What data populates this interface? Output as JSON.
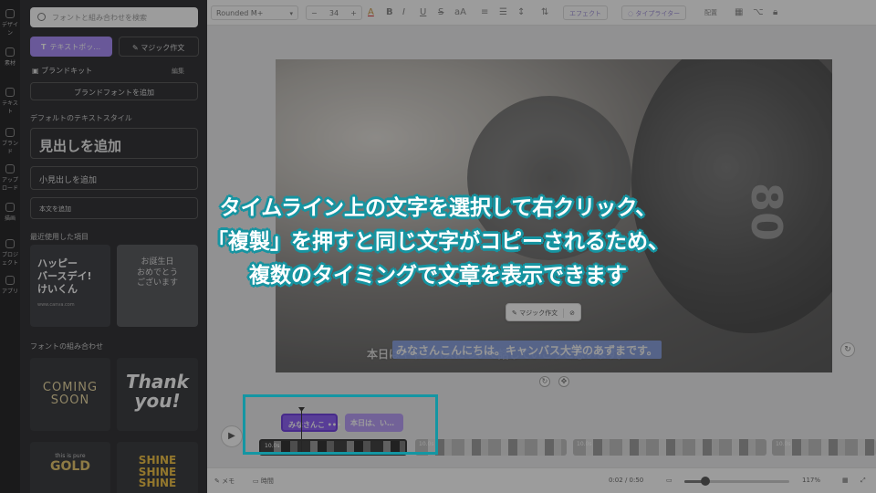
{
  "rail": {
    "items": [
      "デザイン",
      "素材",
      "テキスト",
      "ブランド",
      "アップロード",
      "描画",
      "プロジェクト",
      "アプリ"
    ]
  },
  "panel": {
    "search_placeholder": "フォントと組み合わせを検索",
    "text_box_button": "テキストボッ…",
    "text_box_icon": "T",
    "magic_write_button": "マジック作文",
    "brand_kit": "ブランドキット",
    "brand_kit_edit": "編集",
    "add_brand_font": "ブランドフォントを追加",
    "default_styles_title": "デフォルトのテキストスタイル",
    "add_heading": "見出しを追加",
    "add_subheading": "小見出しを追加",
    "add_body": "本文を追加",
    "recently_used_title": "最近使用した項目",
    "recent_tile_1": [
      "ハッピー",
      "バースデイ!",
      "けいくん"
    ],
    "recent_tile_1_small": "www.canva.com",
    "recent_tile_2": [
      "お誕生日",
      "おめでとう",
      "ございます"
    ],
    "font_combos_title": "フォントの組み合わせ",
    "combo_1": [
      "COMING",
      "SOON"
    ],
    "combo_2": [
      "Thank",
      "you!"
    ],
    "combo_3_small": "this is pure",
    "combo_3_big": "GOLD",
    "combo_4": [
      "SHINE",
      "SHINE",
      "SHINE"
    ]
  },
  "toolbar": {
    "font_name": "Rounded M+",
    "font_size": "34",
    "minus": "−",
    "plus": "+",
    "color_icon": "A",
    "bold": "B",
    "italic": "I",
    "underline": "U",
    "strike": "S",
    "case": "aA",
    "effects": "エフェクト",
    "typewriter": "タイプライター",
    "position": "配置"
  },
  "canvas": {
    "subtitle_back": "本日はキャンバスについて話していこうと思います。",
    "subtitle_selected": "みなさんこんにちは。キャンバス大学のあずまです。",
    "magic_popup": "マジック作文",
    "photo_digits": "80"
  },
  "timeline": {
    "clip_1": "みなさんこ",
    "clip_1_more": "•••",
    "clip_2": "本日は、い…",
    "video_label_1": "10.0s",
    "video_label_2": "10.0s",
    "video_label_3": "10.0s",
    "video_label_4": "10.0s"
  },
  "statusbar": {
    "memo": "メモ",
    "duration": "時間",
    "time": "0:02 / 0:50",
    "zoom": "117%",
    "zoom_fraction": 0.2
  },
  "caption": {
    "line1": "タイムライン上の文字を選択して右クリック、",
    "line2": "「複製」を押すと同じ文字がコピーされるため、",
    "line3": "複数のタイミングで文章を表示できます"
  },
  "colors": {
    "accent_purple": "#8b5cf6",
    "highlight_teal": "#1496a3"
  }
}
